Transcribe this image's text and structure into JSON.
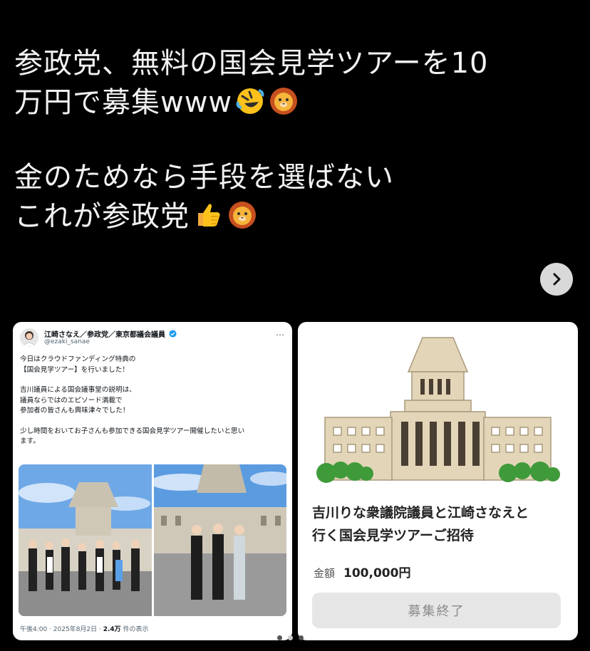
{
  "post": {
    "lines": [
      "参政党、無料の国会見学ツアーを10",
      "万円で募集www",
      "金のためなら手段を選ばない",
      "これが参政党"
    ],
    "emojis": [
      "rolling-on-floor-laughing",
      "lion-face",
      "thumbs-up",
      "lion-face"
    ]
  },
  "carousel": {
    "next_icon": "chevron-right-icon",
    "page_count": 3,
    "active_page": 2
  },
  "embedded_tweet": {
    "author_name": "江崎さなえ／参政党／東京都議会議員",
    "handle": "@ezaki_sanae",
    "more": "…",
    "paragraphs": [
      [
        "今日はクラウドファンディング特典の",
        "【国会見学ツアー】を行いました！"
      ],
      [
        "吉川議員による国会議事堂の説明は、",
        "議員ならではのエピソード満載で",
        "参加者の皆さんも興味津々でした！"
      ],
      [
        "少し時間をおいてお子さんも参加できる国会見学ツアー開催したいと思い",
        "ます。"
      ]
    ],
    "footer_time": "午後4:00 · 2025年8月2日 · ",
    "footer_views": "2.4万",
    "footer_suffix": " 件の表示"
  },
  "offer_card": {
    "title_line1": "吉川りな衆議院議員と江崎さなえと",
    "title_line2": "行く国会見学ツアーご招待",
    "price_label": "金額",
    "price_value": "100,000円",
    "status_button": "募集終了"
  },
  "colors": {
    "background": "#000000",
    "verified": "#1d9bf0",
    "building": "#e3d6b8",
    "button_disabled": "#e6e6e6"
  }
}
